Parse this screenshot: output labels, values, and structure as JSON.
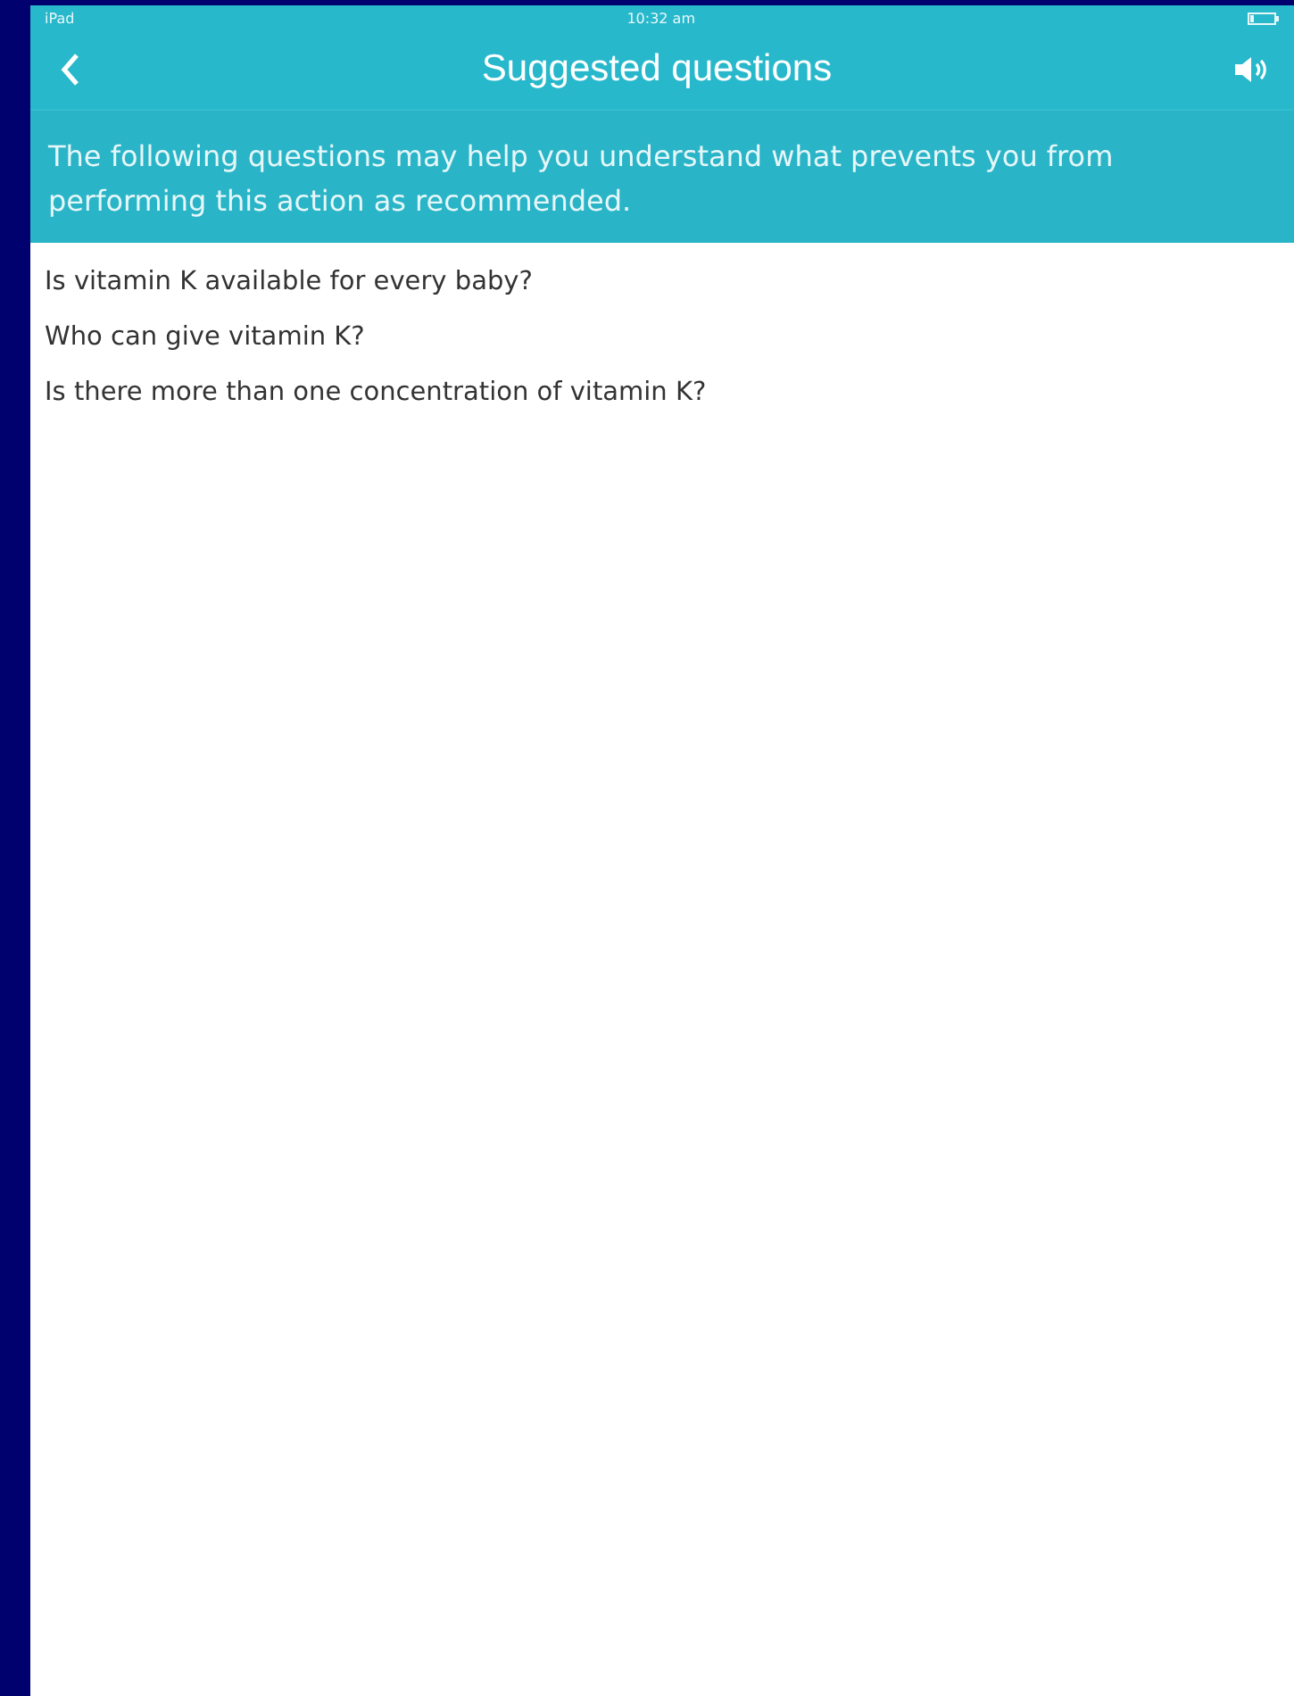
{
  "status_bar": {
    "carrier": "iPad",
    "time": "10:32 am"
  },
  "nav_bar": {
    "title": "Suggested questions"
  },
  "intro": "The following questions may help you understand what prevents you from performing this action as recommended.",
  "questions": [
    "Is vitamin K available for every baby?",
    "Who can give vitamin K?",
    "Is there more than one concentration of vitamin K?"
  ]
}
